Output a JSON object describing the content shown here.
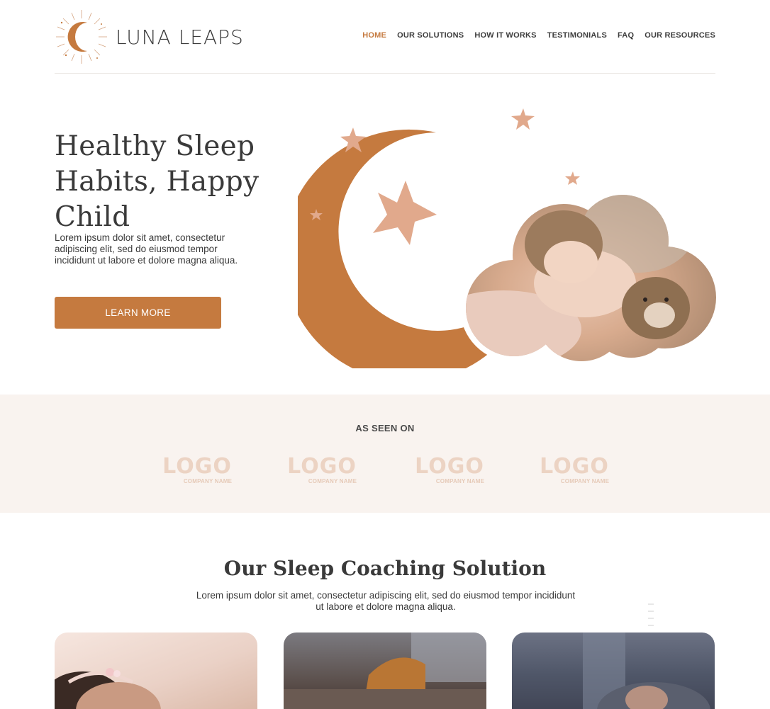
{
  "brand": {
    "name": "LUNA LEAPS"
  },
  "nav": {
    "items": [
      {
        "label": "HOME",
        "active": true
      },
      {
        "label": "OUR SOLUTIONS",
        "active": false
      },
      {
        "label": "HOW IT WORKS",
        "active": false
      },
      {
        "label": "TESTIMONIALS",
        "active": false
      },
      {
        "label": "FAQ",
        "active": false
      },
      {
        "label": "OUR RESOURCES",
        "active": false
      }
    ]
  },
  "hero": {
    "title": "Healthy Sleep Habits, Happy Child",
    "text": "Lorem ipsum dolor sit amet, consectetur adipiscing elit, sed do eiusmod tempor incididunt ut labore et dolore magna aliqua.",
    "button_label": "LEARN MORE"
  },
  "as_seen_on": {
    "title": "AS SEEN ON",
    "logos": [
      {
        "word": "LOGO",
        "sub": "COMPANY NAME"
      },
      {
        "word": "LOGO",
        "sub": "COMPANY NAME"
      },
      {
        "word": "LOGO",
        "sub": "COMPANY NAME"
      },
      {
        "word": "LOGO",
        "sub": "COMPANY NAME"
      }
    ]
  },
  "solution": {
    "title": "Our Sleep Coaching Solution",
    "text": "Lorem ipsum dolor sit amet, consectetur adipiscing elit, sed do eiusmod tempor incididunt ut labore et dolore magna aliqua."
  },
  "colors": {
    "accent": "#c57a3f",
    "star": "#e1a98c",
    "band_bg": "#f9f3ef",
    "logo_tint": "#ecd3c3"
  },
  "icons": {
    "brand_logo": "crescent-moon-sunburst-icon"
  }
}
